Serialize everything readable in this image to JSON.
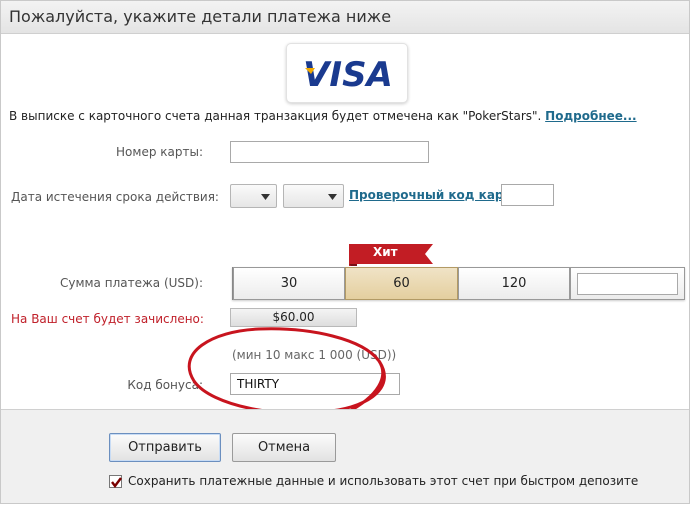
{
  "title": "Пожалуйста, укажите детали платежа ниже",
  "logo": {
    "text": "VISA",
    "icon": "visa-logo-icon",
    "colors": {
      "blue": "#1a3a8f",
      "gold": "#f2a900"
    }
  },
  "info": {
    "text": "В выписке с карточного счета данная транзакция будет отмечена как \"PokerStars\". ",
    "link": "Подробнее..."
  },
  "form": {
    "card_number_label": "Номер карты:",
    "card_number_value": "",
    "expiry_label": "Дата истечения срока действия:",
    "expiry_month": "",
    "expiry_year": "",
    "cvv_link": "Проверочный код карты:",
    "cvv_value": "",
    "amount_label": "Сумма платежа (USD):",
    "amounts": [
      "30",
      "60",
      "120"
    ],
    "selected_amount": "60",
    "custom_amount_value": "",
    "hit_badge": "Хит",
    "credited_label": "На Ваш счет будет зачислено:",
    "credited_value": "$60.00",
    "limits": "(мин 10 макс 1 000 (USD))",
    "bonus_label": "Код бонуса:",
    "bonus_value": "THIRTY"
  },
  "buttons": {
    "submit": "Отправить",
    "cancel": "Отмена"
  },
  "save_checkbox": {
    "checked": true,
    "label": "Сохранить платежные данные и использовать этот счет при быстром депозите"
  },
  "colors": {
    "link": "#1f6a8c",
    "error_label": "#c0202a",
    "annotation_circle": "#c8141e",
    "hit_badge": "#c21d24"
  }
}
